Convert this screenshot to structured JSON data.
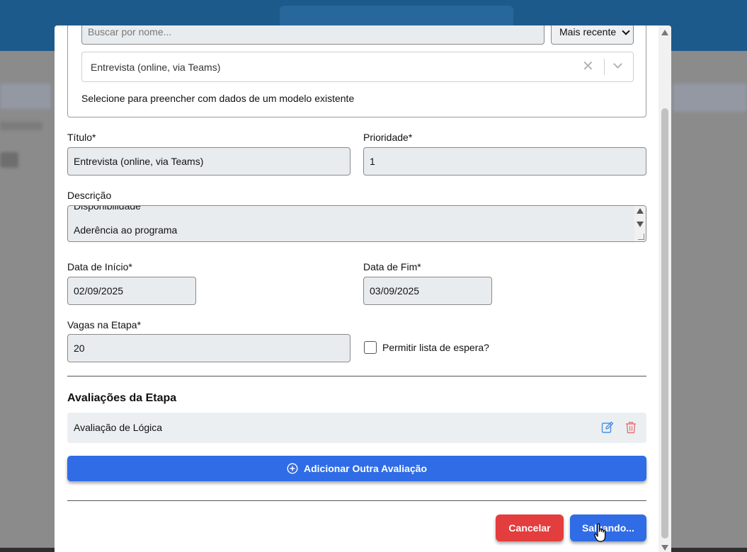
{
  "template": {
    "search_placeholder": "Buscar por nome...",
    "sort_selected": "Mais recente",
    "selected_template": "Entrevista (online, via Teams)",
    "hint": "Selecione para preencher com dados de um modelo existente"
  },
  "form": {
    "title_label": "Título*",
    "title_value": "Entrevista (online, via Teams)",
    "priority_label": "Prioridade*",
    "priority_value": "1",
    "description_label": "Descrição",
    "description_lines": [
      "Disponibilidade",
      "Aderência ao programa"
    ],
    "start_label": "Data de Início*",
    "start_value": "02/09/2025",
    "end_label": "Data de Fim*",
    "end_value": "03/09/2025",
    "slots_label": "Vagas na Etapa*",
    "slots_value": "20",
    "waitlist_label": "Permitir lista de espera?",
    "waitlist_checked": false
  },
  "evaluations": {
    "title": "Avaliações da Etapa",
    "items": [
      {
        "name": "Avaliação de Lógica"
      }
    ],
    "add_label": "Adicionar Outra Avaliação"
  },
  "footer": {
    "cancel_label": "Cancelar",
    "save_label": "Salvando..."
  },
  "colors": {
    "primary": "#2f6ce5",
    "danger": "#e33d3d",
    "edit_icon": "#4a90e2",
    "delete_icon": "#e57373"
  }
}
